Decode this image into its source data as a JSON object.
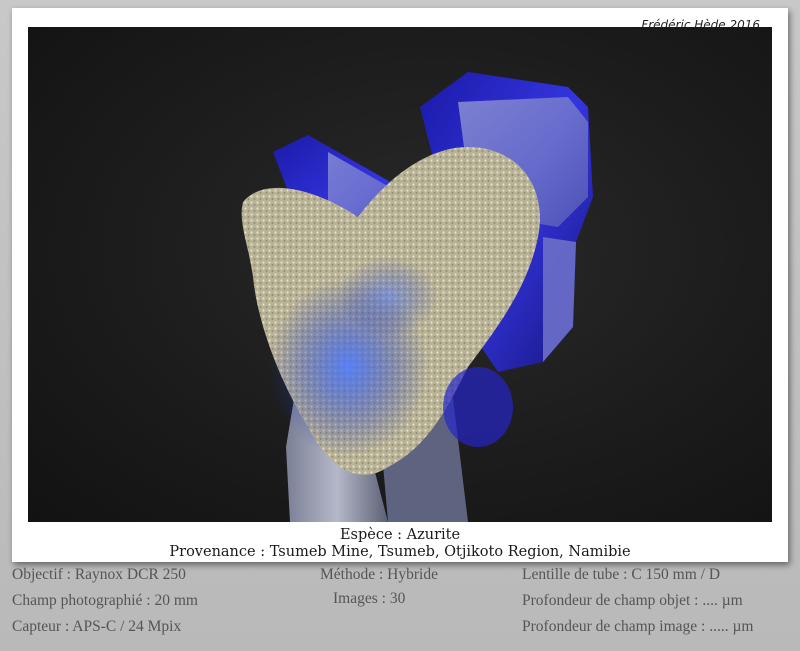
{
  "photo": {
    "signature": "Frédéric Hède 2016",
    "subject": "azurite-crystal-specimen"
  },
  "caption": {
    "species": "Espèce : Azurite",
    "locality": "Provenance : Tsumeb Mine, Tsumeb, Otjikoto Region, Namibie"
  },
  "specs": {
    "left": [
      "Objectif : Raynox DCR 250",
      "Champ photographié : 20 mm",
      "Capteur : APS-C / 24 Mpix"
    ],
    "middle": [
      "Méthode : Hybride",
      "Images : 30"
    ],
    "right": [
      "Lentille de tube : C 150 mm / D",
      "Profondeur de champ objet : .... µm",
      "Profondeur de champ image : ..... µm"
    ]
  },
  "colors": {
    "background": "#1c1c1c",
    "azurite": "#2a2ad8",
    "matrix": "#cfc7a8",
    "frame": "#bdbdbd"
  }
}
